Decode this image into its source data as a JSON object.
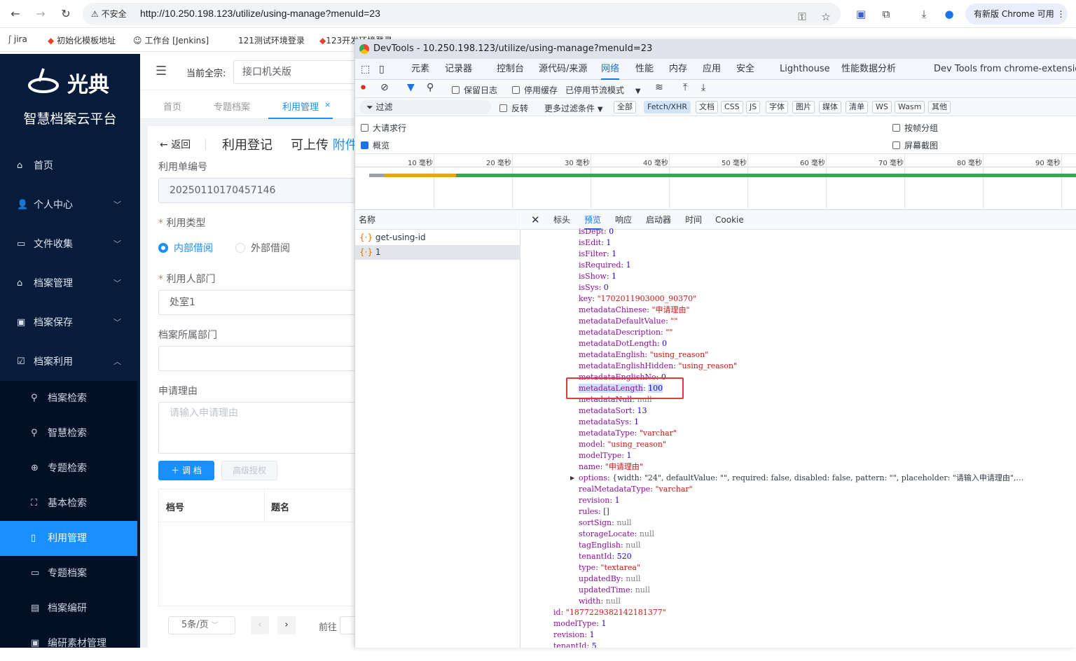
{
  "browser": {
    "security_label": "不安全",
    "url": "http://10.250.198.123/utilize/using-manage?menuId=23",
    "update_label": "有新版 Chrome 可用",
    "bookmarks": [
      "jira",
      "初始化模板地址",
      "工作台 [Jenkins]",
      "121测试环境登录",
      "123开发环境登录"
    ]
  },
  "app": {
    "logo_text": "光典",
    "platform_title": "智慧档案云平台",
    "menu": [
      {
        "label": "首页",
        "icon": "home-icon"
      },
      {
        "label": "个人中心",
        "icon": "user-icon"
      },
      {
        "label": "文件收集",
        "icon": "briefcase-icon"
      },
      {
        "label": "档案管理",
        "icon": "bank-icon"
      },
      {
        "label": "档案保存",
        "icon": "save-icon"
      },
      {
        "label": "档案利用",
        "icon": "checklist-icon"
      }
    ],
    "submenu": [
      {
        "label": "档案检索",
        "icon": "search-icon"
      },
      {
        "label": "智慧检索",
        "icon": "search-icon"
      },
      {
        "label": "专题检索",
        "icon": "compass-icon"
      },
      {
        "label": "基本检索",
        "icon": "scan-icon"
      },
      {
        "label": "利用管理",
        "icon": "book-icon"
      },
      {
        "label": "专题档案",
        "icon": "folder-icon"
      },
      {
        "label": "档案编研",
        "icon": "document-icon"
      },
      {
        "label": "编研素材管理",
        "icon": "material-icon"
      }
    ],
    "topbar": {
      "fonds_label": "当前全宗:",
      "fonds_value": "接口机关版"
    },
    "tabs": [
      "首页",
      "专题档案",
      "利用管理"
    ],
    "form": {
      "back_label": "返回",
      "title": "利用登记",
      "upload_label": "可上传",
      "attach_link": "附件",
      "id_label": "利用单编号",
      "id_value": "20250110170457146",
      "type_label": "利用类型",
      "type_internal": "内部借阅",
      "type_external": "外部借阅",
      "dept_label": "利用人部门",
      "dept_value": "处室1",
      "archive_dept_label": "档案所属部门",
      "reason_label": "申请理由",
      "reason_placeholder": "请输入申请理由",
      "transfer_btn": "调 档",
      "advanced_btn": "高级授权",
      "col_code": "档号",
      "col_title": "题名",
      "page_size": "5条/页",
      "goto_label": "前往"
    }
  },
  "devtools": {
    "title": "DevTools - 10.250.198.123/utilize/using-manage?menuId=23",
    "tabs": [
      "元素",
      "记录器",
      "控制台",
      "源代码/来源",
      "网络",
      "性能",
      "内存",
      "应用",
      "安全",
      "Lighthouse",
      "性能数据分析",
      "Dev Tools from chrome-extension-b"
    ],
    "active_tab": "网络",
    "toolbar": {
      "preserve_log": "保留日志",
      "disable_cache": "停用缓存",
      "throttle": "已停用节流模式"
    },
    "filter": {
      "placeholder": "过滤",
      "invert": "反转",
      "more": "更多过滤条件",
      "types": [
        "全部",
        "Fetch/XHR",
        "文档",
        "CSS",
        "JS",
        "字体",
        "图片",
        "媒体",
        "清单",
        "WS",
        "Wasm",
        "其他"
      ],
      "active_type": "Fetch/XHR"
    },
    "options": {
      "big_rows": "大请求行",
      "overview": "概览",
      "group_by_frame": "按帧分组",
      "screenshots": "屏幕截图"
    },
    "timeline_ticks": [
      "10 毫秒",
      "20 毫秒",
      "30 毫秒",
      "40 毫秒",
      "50 毫秒",
      "60 毫秒",
      "70 毫秒",
      "80 毫秒",
      "90 毫秒"
    ],
    "request_header": "名称",
    "requests": [
      "get-using-id",
      "1"
    ],
    "preview_tabs": [
      "标头",
      "预览",
      "响应",
      "启动器",
      "时间",
      "Cookie"
    ],
    "active_preview_tab": "预览",
    "preview_lines": [
      {
        "k": "isDept",
        "v": "0",
        "t": "n",
        "indent": 1
      },
      {
        "k": "isEdit",
        "v": "1",
        "t": "n",
        "indent": 1
      },
      {
        "k": "isFilter",
        "v": "1",
        "t": "n",
        "indent": 1
      },
      {
        "k": "isRequired",
        "v": "1",
        "t": "n",
        "indent": 1
      },
      {
        "k": "isShow",
        "v": "1",
        "t": "n",
        "indent": 1
      },
      {
        "k": "isSys",
        "v": "0",
        "t": "n",
        "indent": 1
      },
      {
        "k": "key",
        "v": "\"1702011903000_90370\"",
        "t": "s",
        "indent": 1
      },
      {
        "k": "metadataChinese",
        "v": "\"申请理由\"",
        "t": "s",
        "indent": 1
      },
      {
        "k": "metadataDefaultValue",
        "v": "\"\"",
        "t": "s",
        "indent": 1
      },
      {
        "k": "metadataDescription",
        "v": "\"\"",
        "t": "s",
        "indent": 1
      },
      {
        "k": "metadataDotLength",
        "v": "0",
        "t": "n",
        "indent": 1
      },
      {
        "k": "metadataEnglish",
        "v": "\"using_reason\"",
        "t": "s",
        "indent": 1
      },
      {
        "k": "metadataEnglishHidden",
        "v": "\"using_reason\"",
        "t": "s",
        "indent": 1
      },
      {
        "k": "metadataEnglishNo",
        "v": "0",
        "t": "n",
        "indent": 1
      },
      {
        "k": "metadataLength",
        "v": "100",
        "t": "n",
        "indent": 1
      },
      {
        "k": "metadataNull",
        "v": "null",
        "t": "nl",
        "indent": 1
      },
      {
        "k": "metadataSort",
        "v": "13",
        "t": "n",
        "indent": 1
      },
      {
        "k": "metadataSys",
        "v": "1",
        "t": "n",
        "indent": 1
      },
      {
        "k": "metadataType",
        "v": "\"varchar\"",
        "t": "s",
        "indent": 1
      },
      {
        "k": "model",
        "v": "\"using_reason\"",
        "t": "s",
        "indent": 1
      },
      {
        "k": "modelType",
        "v": "1",
        "t": "n",
        "indent": 1
      },
      {
        "k": "name",
        "v": "\"申请理由\"",
        "t": "s",
        "indent": 1
      },
      {
        "k": "options",
        "v": "{width: \"24\", defaultValue: \"\", required: false, disabled: false, pattern: \"\", placeholder: \"请输入申请理由\",…",
        "t": "o",
        "indent": 1
      },
      {
        "k": "realMetadataType",
        "v": "\"varchar\"",
        "t": "s",
        "indent": 1
      },
      {
        "k": "revision",
        "v": "1",
        "t": "n",
        "indent": 1
      },
      {
        "k": "rules",
        "v": "[]",
        "t": "o",
        "indent": 1
      },
      {
        "k": "sortSign",
        "v": "null",
        "t": "nl",
        "indent": 1
      },
      {
        "k": "storageLocate",
        "v": "null",
        "t": "nl",
        "indent": 1
      },
      {
        "k": "tagEnglish",
        "v": "null",
        "t": "nl",
        "indent": 1
      },
      {
        "k": "tenantId",
        "v": "520",
        "t": "n",
        "indent": 1
      },
      {
        "k": "type",
        "v": "\"textarea\"",
        "t": "s",
        "indent": 1
      },
      {
        "k": "updatedBy",
        "v": "null",
        "t": "nl",
        "indent": 1
      },
      {
        "k": "updatedTime",
        "v": "null",
        "t": "nl",
        "indent": 1
      },
      {
        "k": "width",
        "v": "null",
        "t": "nl",
        "indent": 1
      },
      {
        "k": "id",
        "v": "\"1877229382142181377\"",
        "t": "s",
        "indent": 0
      },
      {
        "k": "modelType",
        "v": "1",
        "t": "n",
        "indent": 0
      },
      {
        "k": "revision",
        "v": "1",
        "t": "n",
        "indent": 0
      },
      {
        "k": "tenantId",
        "v": "5",
        "t": "n",
        "indent": 0
      }
    ],
    "highlighted_key": "metadataLength"
  },
  "colors": {
    "sidebar_bg": "#071b3a",
    "active_menu": "#1890ff",
    "devtools_accent": "#1a73e8",
    "highlight_box": "#e0393e"
  }
}
